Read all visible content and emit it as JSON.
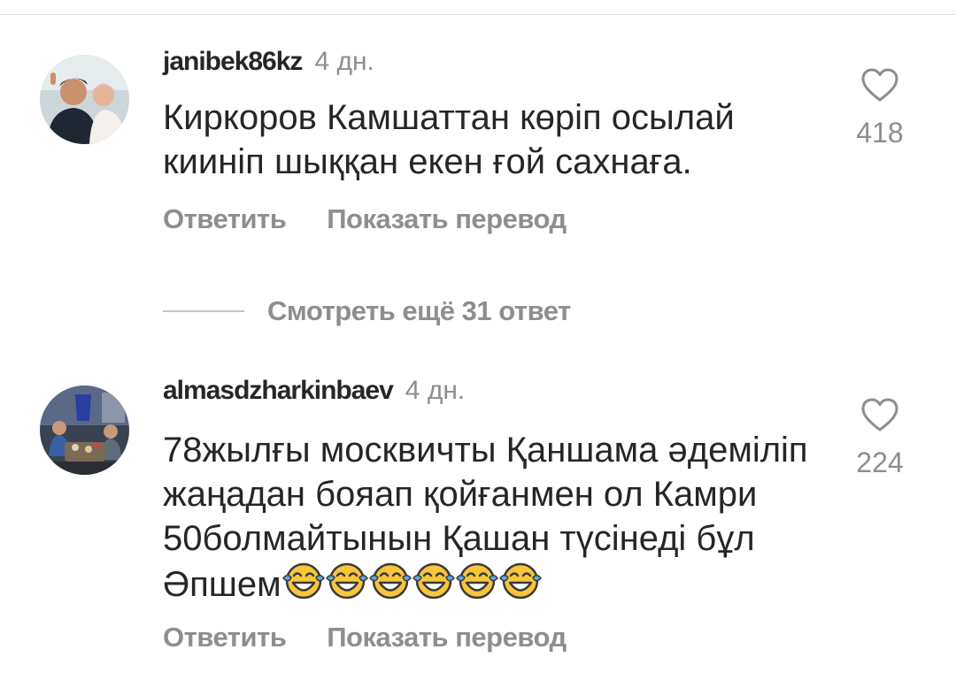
{
  "comments": [
    {
      "username": "janibek86kz",
      "time": "4 дн.",
      "text": "Киркоров Камшаттан көріп осылай кииніп шыққан екен ғой сахнаға.",
      "emojis": [],
      "likes": "418",
      "reply_label": "Ответить",
      "translate_label": "Показать перевод"
    },
    {
      "username": "almasdzharkinbaev",
      "time": "4 дн.",
      "text": "78жылғы москвичты Қаншама әдеміліп жаңадан бояап қойғанмен ол Камри 50болмайтынын Қашан түсінеді бұл Әпшем",
      "emojis": [
        "face-with-tears-of-joy",
        "face-with-tears-of-joy",
        "face-with-tears-of-joy",
        "face-with-tears-of-joy",
        "face-with-tears-of-joy",
        "face-with-tears-of-joy"
      ],
      "likes": "224",
      "reply_label": "Ответить",
      "translate_label": "Показать перевод"
    }
  ],
  "view_more_replies": "Смотреть ещё 31 ответ",
  "icons": {
    "like": "heart-outline-icon",
    "emoji": "face-with-tears-of-joy"
  },
  "colors": {
    "text": "#262626",
    "secondary": "#8e8e8e",
    "emoji_face": "#f7c63b"
  }
}
